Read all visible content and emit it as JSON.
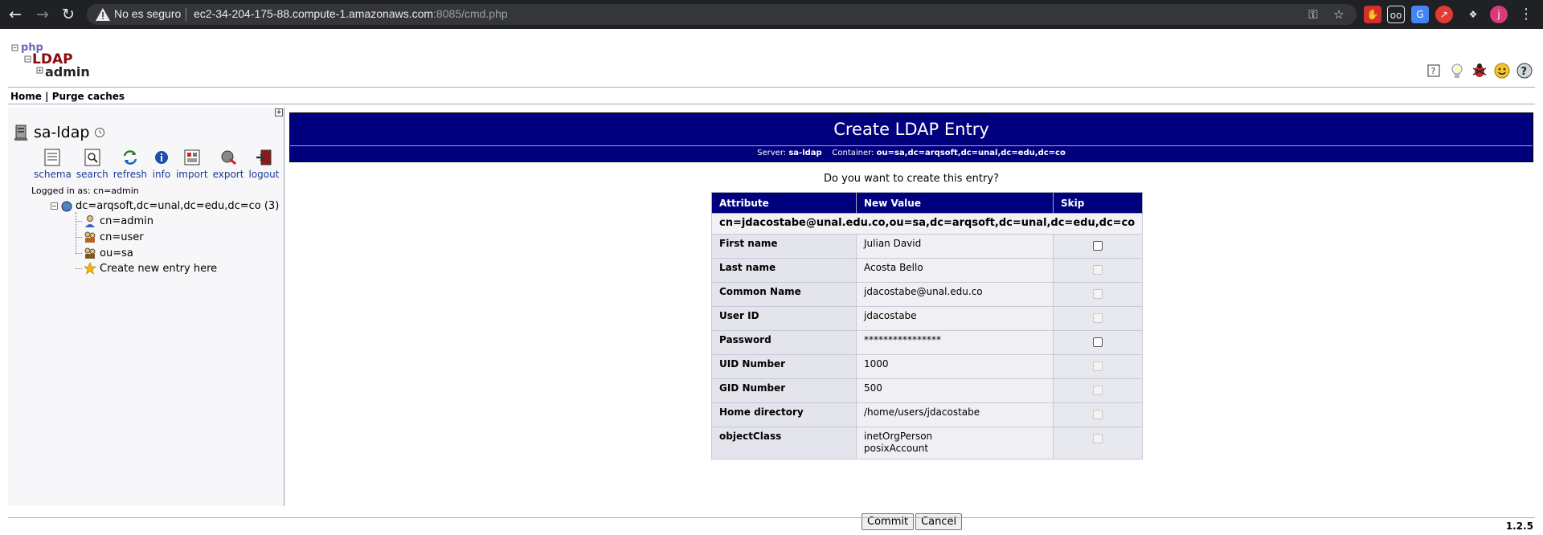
{
  "browser": {
    "security_label": "No es seguro",
    "url_host": "ec2-34-204-175-88.compute-1.amazonaws.com",
    "url_rest": ":8085/cmd.php",
    "profile_initial": "j"
  },
  "nav": {
    "home": "Home",
    "separator": "|",
    "purge": "Purge caches"
  },
  "server": {
    "name": "sa-ldap",
    "logged_in": "Logged in as: cn=admin"
  },
  "tools": [
    {
      "label": "schema",
      "icon": "schema-icon"
    },
    {
      "label": "search",
      "icon": "search-icon"
    },
    {
      "label": "refresh",
      "icon": "refresh-icon"
    },
    {
      "label": "info",
      "icon": "info-icon"
    },
    {
      "label": "import",
      "icon": "import-icon"
    },
    {
      "label": "export",
      "icon": "export-icon"
    },
    {
      "label": "logout",
      "icon": "logout-icon"
    }
  ],
  "tree": {
    "root": "dc=arqsoft,dc=unal,dc=edu,dc=co (3)",
    "items": [
      "cn=admin",
      "cn=user",
      "ou=sa",
      "Create new entry here"
    ]
  },
  "page": {
    "title": "Create LDAP Entry",
    "server_label": "Server:",
    "server_value": "sa-ldap",
    "container_label": "Container:",
    "container_value": "ou=sa,dc=arqsoft,dc=unal,dc=edu,dc=co",
    "question": "Do you want to create this entry?"
  },
  "table": {
    "headers": [
      "Attribute",
      "New Value",
      "Skip"
    ],
    "dn": "cn=jdacostabe@unal.edu.co,ou=sa,dc=arqsoft,dc=unal,dc=edu,dc=co",
    "rows": [
      {
        "attr": "First name",
        "value": "Julian David",
        "skip_enabled": true
      },
      {
        "attr": "Last name",
        "value": "Acosta Bello",
        "skip_enabled": false
      },
      {
        "attr": "Common Name",
        "value": "jdacostabe@unal.edu.co",
        "skip_enabled": false
      },
      {
        "attr": "User ID",
        "value": "jdacostabe",
        "skip_enabled": false
      },
      {
        "attr": "Password",
        "value": "****************",
        "skip_enabled": true
      },
      {
        "attr": "UID Number",
        "value": "1000",
        "skip_enabled": false
      },
      {
        "attr": "GID Number",
        "value": "500",
        "skip_enabled": false
      },
      {
        "attr": "Home directory",
        "value": "/home/users/jdacostabe",
        "skip_enabled": false
      }
    ],
    "objectclass_attr": "objectClass",
    "objectclass_values": [
      "inetOrgPerson",
      "posixAccount"
    ]
  },
  "buttons": {
    "commit": "Commit",
    "cancel": "Cancel"
  },
  "version": "1.2.5"
}
